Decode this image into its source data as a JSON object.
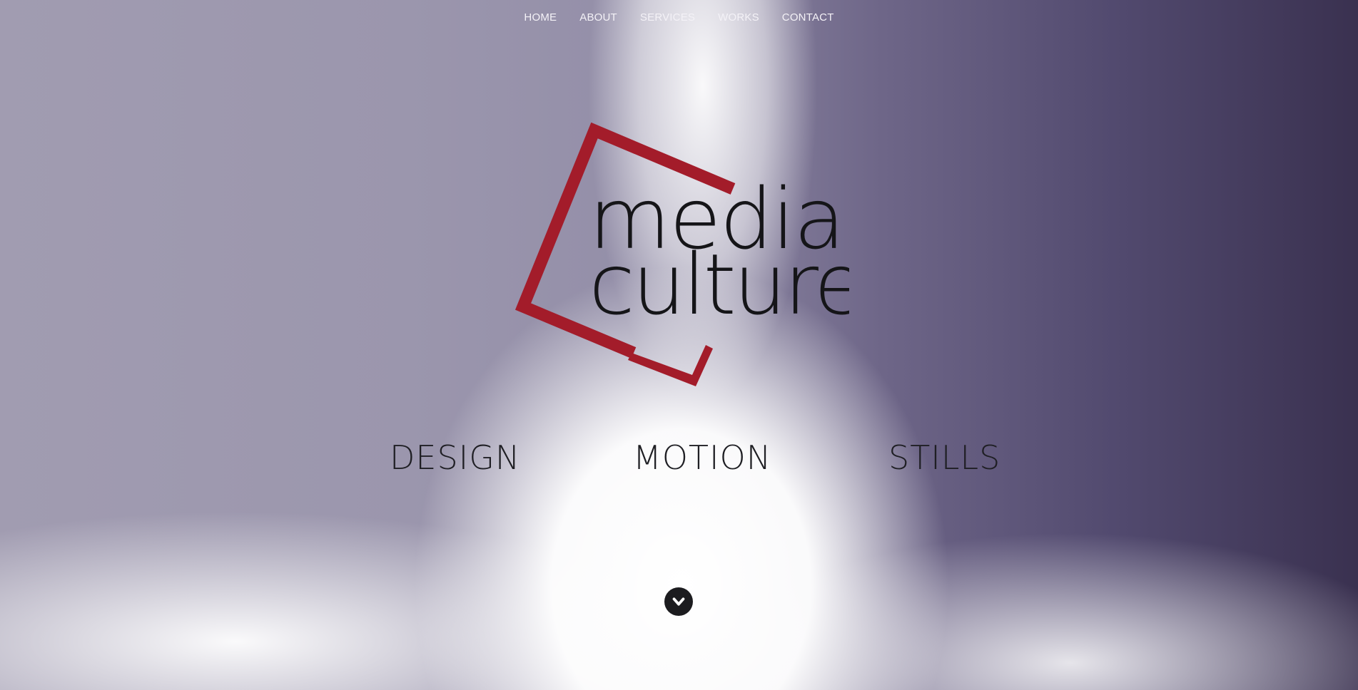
{
  "nav": {
    "items": [
      {
        "label": "HOME"
      },
      {
        "label": "ABOUT"
      },
      {
        "label": "SERVICES"
      },
      {
        "label": "WORKS"
      },
      {
        "label": "CONTACT"
      }
    ]
  },
  "logo": {
    "line1": "media",
    "line2": "culture",
    "frame_color": "#a31c2a",
    "text_color": "#151518"
  },
  "categories": [
    {
      "label": "DESIGN"
    },
    {
      "label": "MOTION"
    },
    {
      "label": "STILLS"
    }
  ],
  "scroll_icon": "chevron-down-icon"
}
